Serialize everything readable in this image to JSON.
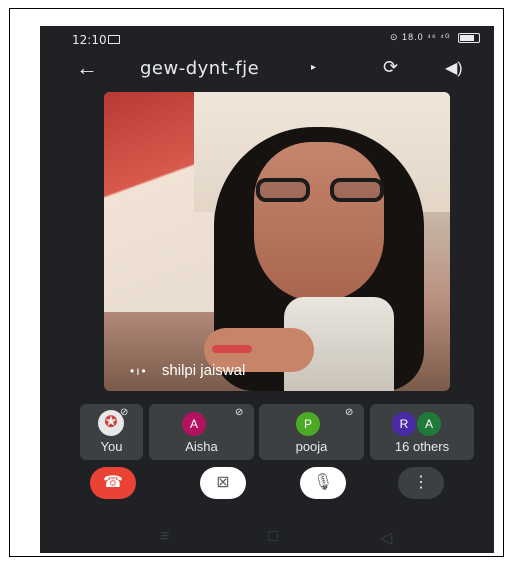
{
  "status_bar": {
    "time": "12:10",
    "indicators": "⊙ 18.0 ⁴⁶ ⁴ᴳ",
    "battery": ""
  },
  "top_bar": {
    "meeting_code": "gew-dynt-fje",
    "caret": "▸",
    "back_icon": "←",
    "switch_camera_icon": "⟳",
    "speaker_icon": "◀)"
  },
  "main_video": {
    "participant_name": "shilpi jaiswal",
    "audio_indicator": "•ı•"
  },
  "participants": [
    {
      "label": "You",
      "initial": "✪",
      "muted": true
    },
    {
      "label": "Aisha",
      "initial": "A",
      "muted": true
    },
    {
      "label": "pooja",
      "initial": "P",
      "muted": true
    },
    {
      "label": "16 others",
      "initials": [
        "R",
        "A"
      ],
      "muted": false
    }
  ],
  "controls": {
    "end_call_icon": "☎",
    "camera_off_icon": "⊠",
    "mic_off_icon": "🎙",
    "more_icon": "⋮"
  },
  "nav": {
    "menu_icon": "≡",
    "home_icon": "□",
    "back_icon": "◁"
  },
  "colors": {
    "background": "#202124",
    "tile": "#3c4043",
    "end_call": "#ea4335",
    "aisha": "#b3135e",
    "pooja": "#4caa25",
    "r_avatar": "#4b2aa8",
    "a_avatar": "#1f7a3a"
  }
}
